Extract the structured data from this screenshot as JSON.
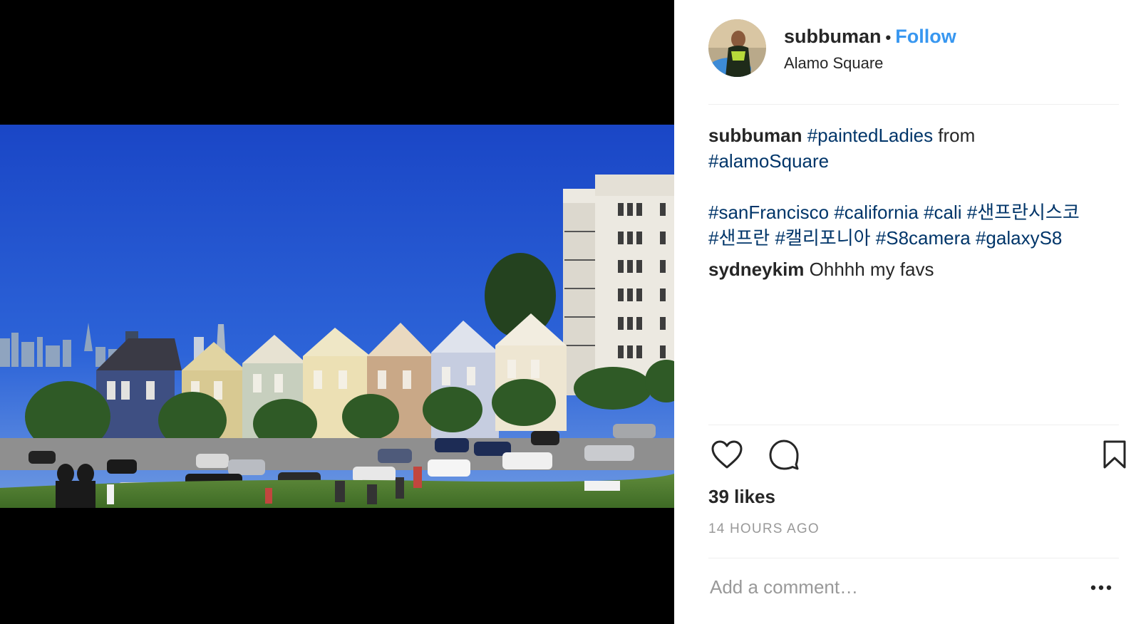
{
  "post": {
    "media_alt": "Painted Ladies row houses at Alamo Square with the San Francisco skyline",
    "author": {
      "username": "subbuman",
      "separator": "•",
      "follow_label": "Follow",
      "location": "Alamo Square",
      "avatar_icon": "profile-photo-avatar"
    },
    "caption": {
      "username": "subbuman",
      "tag_1": "#paintedLadies",
      "text_from": " from",
      "tag_2": "#alamoSquare",
      "tags_line": [
        "#sanFrancisco",
        "#california",
        "#cali",
        "#샌프란시스코",
        "#샌프란",
        "#캘리포니아",
        "#S8camera",
        "#galaxyS8"
      ]
    },
    "comment": {
      "username": "sydneykim",
      "text": "Ohhhh my favs"
    },
    "actions": {
      "like_icon": "heart-outline-icon",
      "comment_icon": "speech-bubble-icon",
      "save_icon": "bookmark-icon"
    },
    "likes_label": "39 likes",
    "time_label": "14 HOURS AGO",
    "add_comment_placeholder": "Add a comment…",
    "more_icon": "more-options-icon"
  },
  "colors": {
    "follow": "#3897f0",
    "hashtag": "#003569",
    "text": "#262626",
    "muted": "#999999",
    "divider": "#efefef",
    "sky": "#1f4fc4"
  }
}
